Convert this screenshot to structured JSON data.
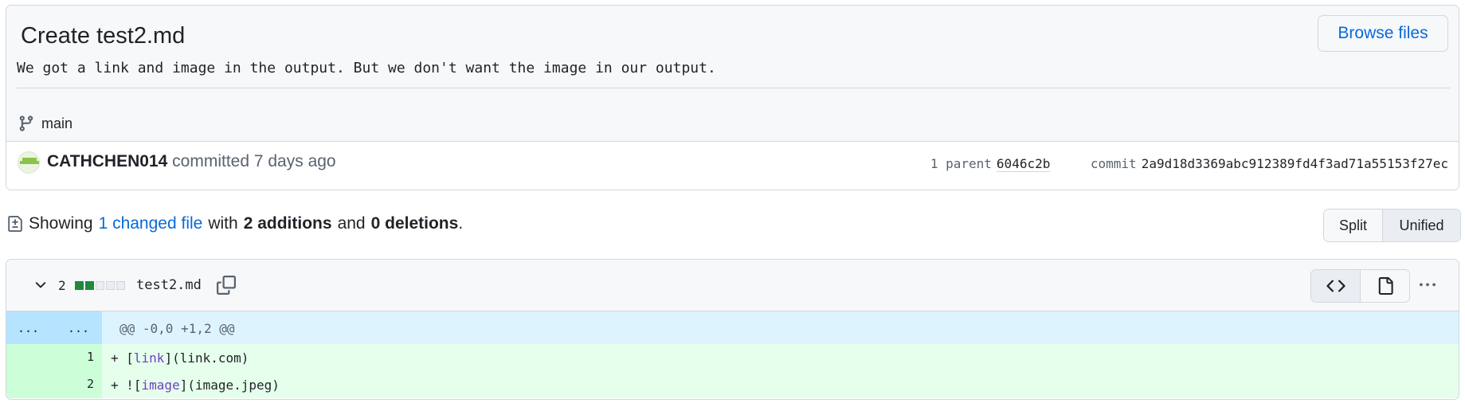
{
  "commit": {
    "title": "Create test2.md",
    "description": "We got a link and image in the output. But we don't want the image in our output.",
    "browse_label": "Browse files",
    "branch": "main",
    "author": "CATHCHEN014",
    "committed_text": "committed",
    "time": "7 days ago",
    "parent_label": "1 parent",
    "parent_sha": "6046c2b",
    "commit_label": "commit",
    "sha": "2a9d18d3369abc912389fd4f3ad71a55153f27ec"
  },
  "summary": {
    "showing": "Showing",
    "changed_files": "1 changed file",
    "with": "with",
    "additions": "2 additions",
    "and": "and",
    "deletions": "0 deletions",
    "period": "."
  },
  "view_toggle": {
    "split": "Split",
    "unified": "Unified",
    "selected": "Unified"
  },
  "file": {
    "change_count": "2",
    "name": "test2.md",
    "blocks": [
      "#1f883d",
      "#1f883d",
      "#eaeef2",
      "#eaeef2",
      "#eaeef2"
    ],
    "hunk": {
      "left": "...",
      "right": "...",
      "header": "@@ -0,0 +1,2 @@"
    },
    "lines": [
      {
        "num": "1",
        "prefix": "+ ",
        "pre": "[",
        "kw": "link",
        "post": "](link.com)"
      },
      {
        "num": "2",
        "prefix": "+ ",
        "pre": "![",
        "kw": "image",
        "post": "](image.jpeg)"
      }
    ]
  },
  "colors": {
    "accent": "#0969da",
    "addition_bg": "#e6ffec",
    "addition_gutter": "#ccffd8",
    "hunk_bg": "#ddf4ff"
  }
}
